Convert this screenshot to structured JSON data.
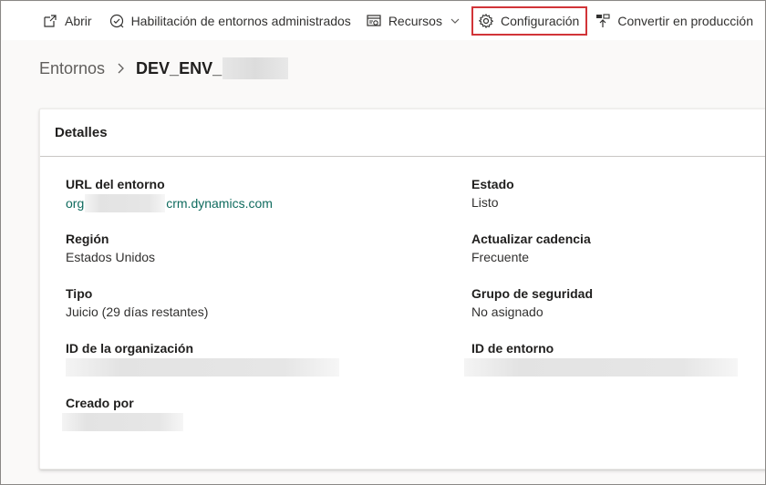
{
  "toolbar": {
    "open_label": "Abrir",
    "managed_label": "Habilitación de entornos administrados",
    "resources_label": "Recursos",
    "settings_label": "Configuración",
    "convert_label": "Convertir en producción",
    "highlight_color": "#d13438"
  },
  "breadcrumb": {
    "parent": "Entornos",
    "current": "DEV_ENV_"
  },
  "details": {
    "title": "Detalles",
    "url": {
      "label": "URL del entorno",
      "prefix": "org",
      "suffix": "crm.dynamics.com"
    },
    "region": {
      "label": "Región",
      "value": "Estados Unidos"
    },
    "type": {
      "label": "Tipo",
      "value": "Juicio (29 días restantes)"
    },
    "org_id": {
      "label": "ID de la organización"
    },
    "created_by": {
      "label": "Creado por"
    },
    "state": {
      "label": "Estado",
      "value": "Listo"
    },
    "cadence": {
      "label": "Actualizar cadencia",
      "value": "Frecuente"
    },
    "security": {
      "label": "Grupo de seguridad",
      "value": "No asignado"
    },
    "env_id": {
      "label": "ID de entorno"
    }
  },
  "colors": {
    "link": "#0f6b5e",
    "background": "#faf9f8"
  }
}
